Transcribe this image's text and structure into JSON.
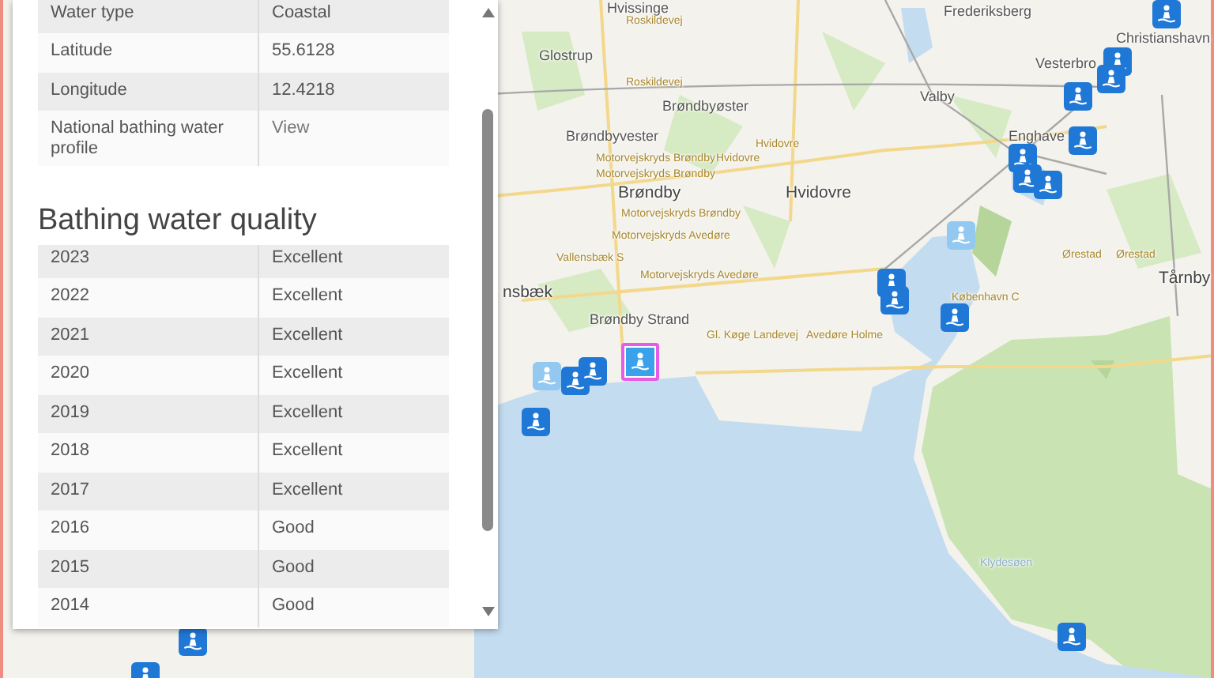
{
  "map": {
    "labels": [
      {
        "text": "Hvissinge",
        "kind": "place"
      },
      {
        "text": "Frederiksberg",
        "kind": "place"
      },
      {
        "text": "Christianshavn",
        "kind": "place"
      },
      {
        "text": "Glostrup",
        "kind": "place"
      },
      {
        "text": "Vesterbro",
        "kind": "place"
      },
      {
        "text": "Valby",
        "kind": "place"
      },
      {
        "text": "Brøndbyøster",
        "kind": "place"
      },
      {
        "text": "Brøndbyvester",
        "kind": "place"
      },
      {
        "text": "Enghave",
        "kind": "place"
      },
      {
        "text": "Brøndby",
        "kind": "town"
      },
      {
        "text": "Hvidovre",
        "kind": "town"
      },
      {
        "text": "Brøndby Strand",
        "kind": "place"
      },
      {
        "text": "Tårnby",
        "kind": "town"
      },
      {
        "text": "nsbæk",
        "kind": "town"
      },
      {
        "text": "Roskildevej",
        "kind": "road"
      },
      {
        "text": "Roskildevej",
        "kind": "road"
      },
      {
        "text": "Motorvejskryds Brøndby",
        "kind": "road"
      },
      {
        "text": "Hvidovre",
        "kind": "road"
      },
      {
        "text": "Hvidovre",
        "kind": "road"
      },
      {
        "text": "Motorvejskryds Brøndby",
        "kind": "road"
      },
      {
        "text": "Motorvejskryds Brøndby",
        "kind": "road"
      },
      {
        "text": "Motorvejskryds Avedøre",
        "kind": "road"
      },
      {
        "text": "Vallensbæk S",
        "kind": "road"
      },
      {
        "text": "Motorvejskryds Avedøre",
        "kind": "road"
      },
      {
        "text": "Gl. Køge Landevej",
        "kind": "road"
      },
      {
        "text": "Avedøre Holme",
        "kind": "road"
      },
      {
        "text": "København C",
        "kind": "road"
      },
      {
        "text": "Ørestad",
        "kind": "road"
      },
      {
        "text": "Ørestad",
        "kind": "road"
      },
      {
        "text": "Klydesøen",
        "kind": "water"
      }
    ],
    "pins": [
      {
        "kind": "active",
        "selected": false
      },
      {
        "kind": "active",
        "selected": false
      },
      {
        "kind": "active",
        "selected": false
      },
      {
        "kind": "active",
        "selected": false
      },
      {
        "kind": "active",
        "selected": false
      },
      {
        "kind": "active",
        "selected": false
      },
      {
        "kind": "active",
        "selected": false
      },
      {
        "kind": "active",
        "selected": false
      },
      {
        "kind": "faded",
        "selected": false
      },
      {
        "kind": "active",
        "selected": false
      },
      {
        "kind": "active",
        "selected": false
      },
      {
        "kind": "active",
        "selected": false
      },
      {
        "kind": "faded",
        "selected": false
      },
      {
        "kind": "active",
        "selected": false
      },
      {
        "kind": "active",
        "selected": false
      },
      {
        "kind": "active",
        "selected": true
      },
      {
        "kind": "active",
        "selected": false
      },
      {
        "kind": "active",
        "selected": false
      },
      {
        "kind": "active",
        "selected": false
      },
      {
        "kind": "active",
        "selected": false
      }
    ]
  },
  "popup": {
    "details": [
      {
        "label": "Water type",
        "value": "Coastal",
        "kind": "text"
      },
      {
        "label": "Latitude",
        "value": "55.6128",
        "kind": "text"
      },
      {
        "label": "Longitude",
        "value": "12.4218",
        "kind": "text"
      },
      {
        "label": "National bathing water profile",
        "value": "View",
        "kind": "link"
      }
    ],
    "quality_title": "Bathing water quality",
    "quality": [
      {
        "year": "2023",
        "rating": "Excellent"
      },
      {
        "year": "2022",
        "rating": "Excellent"
      },
      {
        "year": "2021",
        "rating": "Excellent"
      },
      {
        "year": "2020",
        "rating": "Excellent"
      },
      {
        "year": "2019",
        "rating": "Excellent"
      },
      {
        "year": "2018",
        "rating": "Excellent"
      },
      {
        "year": "2017",
        "rating": "Excellent"
      },
      {
        "year": "2016",
        "rating": "Good"
      },
      {
        "year": "2015",
        "rating": "Good"
      },
      {
        "year": "2014",
        "rating": "Good"
      }
    ]
  }
}
